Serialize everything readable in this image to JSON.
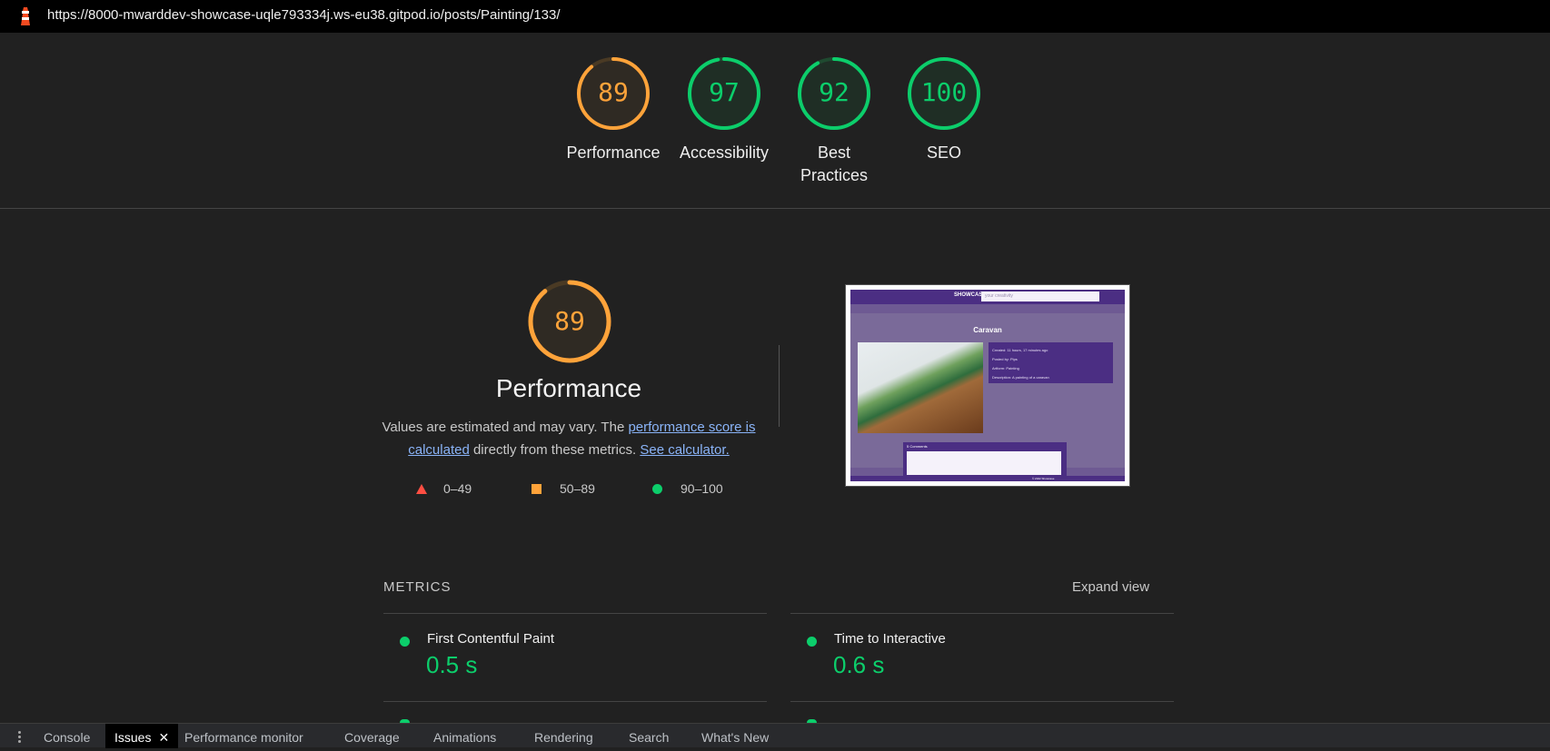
{
  "url_bar": {
    "url": "https://8000-mwarddev-showcase-uqle793334j.ws-eu38.gitpod.io/posts/Painting/133/",
    "logo_icon": "lighthouse-icon"
  },
  "gauges": [
    {
      "label": "Performance",
      "score": "89",
      "score_value": 89,
      "color": "#ffa33a"
    },
    {
      "label": "Accessibility",
      "score": "97",
      "score_value": 97,
      "color": "#0cce6b"
    },
    {
      "label_line1": "Best",
      "label_line2": "Practices",
      "score": "92",
      "score_value": 92,
      "color": "#0cce6b"
    },
    {
      "label": "SEO",
      "score": "100",
      "score_value": 100,
      "color": "#0cce6b"
    }
  ],
  "performance": {
    "score": "89",
    "score_value": 89,
    "title": "Performance",
    "desc_prefix": "Values are estimated and may vary. The ",
    "link1": "performance score is calculated",
    "desc_middle": " directly from these metrics. ",
    "link2": "See calculator."
  },
  "legend": {
    "fail": "0–49",
    "average": "50–89",
    "pass": "90–100",
    "colors": {
      "fail": "#ff4e42",
      "average": "#ffa33a",
      "pass": "#0cce6b"
    }
  },
  "thumbnail": {
    "nav_logo": "SHOWCASE",
    "nav_search": "your creativity",
    "title": "Caravan",
    "info_lines": [
      "Created: 11 hours, 17 minutes ago",
      "Posted by: Pips",
      "Artform: Painting",
      "Description: A painting of a caravan"
    ],
    "comments_header": "5 Comments",
    "footer": "© 2022 Showcase"
  },
  "metrics": {
    "label": "METRICS",
    "expand": "Expand view",
    "items": [
      {
        "name": "First Contentful Paint",
        "value": "0.5 s"
      },
      {
        "name": "Time to Interactive",
        "value": "0.6 s"
      }
    ]
  },
  "drawer": {
    "tabs": [
      "Console",
      "Issues",
      "Performance monitor",
      "Coverage",
      "Animations",
      "Rendering",
      "Search",
      "What's New"
    ],
    "active": "Issues"
  }
}
